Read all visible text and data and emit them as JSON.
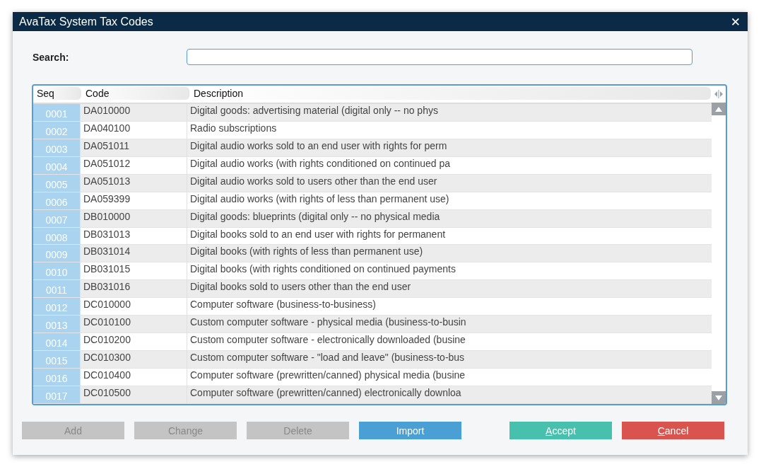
{
  "window": {
    "title": "AvaTax System Tax Codes",
    "close": "✕"
  },
  "search": {
    "label": "Search:"
  },
  "table": {
    "columns": [
      "Seq",
      "Code",
      "Description"
    ],
    "rows": [
      {
        "seq": "0001",
        "code": "DA010000",
        "description": "Digital goods: advertising material (digital only -- no phys"
      },
      {
        "seq": "0002",
        "code": "DA040100",
        "description": "Radio subscriptions"
      },
      {
        "seq": "0003",
        "code": "DA051011",
        "description": "Digital audio works sold to an end user with rights for perm"
      },
      {
        "seq": "0004",
        "code": "DA051012",
        "description": "Digital audio works (with rights conditioned on continued pa"
      },
      {
        "seq": "0005",
        "code": "DA051013",
        "description": "Digital audio works sold to users other than the end user"
      },
      {
        "seq": "0006",
        "code": "DA059399",
        "description": "Digital audio works (with rights of less than permanent use)"
      },
      {
        "seq": "0007",
        "code": "DB010000",
        "description": "Digital goods: blueprints (digital only -- no physical media"
      },
      {
        "seq": "0008",
        "code": "DB031013",
        "description": "Digital books sold to an end user with rights for permanent"
      },
      {
        "seq": "0009",
        "code": "DB031014",
        "description": "Digital books (with rights of less than permanent use)"
      },
      {
        "seq": "0010",
        "code": "DB031015",
        "description": "Digital books (with rights conditioned on continued payments"
      },
      {
        "seq": "0011",
        "code": "DB031016",
        "description": "Digital books sold to users other than the end user"
      },
      {
        "seq": "0012",
        "code": "DC010000",
        "description": "Computer software (business-to-business)"
      },
      {
        "seq": "0013",
        "code": "DC010100",
        "description": "Custom computer software - physical media (business-to-busin"
      },
      {
        "seq": "0014",
        "code": "DC010200",
        "description": "Custom computer software - electronically downloaded (busine"
      },
      {
        "seq": "0015",
        "code": "DC010300",
        "description": "Custom computer software - \"load and leave\" (business-to-bus"
      },
      {
        "seq": "0016",
        "code": "DC010400",
        "description": "Computer software (prewritten/canned) physical media (busine"
      },
      {
        "seq": "0017",
        "code": "DC010500",
        "description": "Computer software (prewritten/canned) electronically downloa"
      }
    ]
  },
  "buttons": [
    {
      "label": "Add",
      "kind": "neutral",
      "disabled": true,
      "underline_first": false
    },
    {
      "label": "Change",
      "kind": "neutral",
      "disabled": true,
      "underline_first": false
    },
    {
      "label": "Delete",
      "kind": "neutral",
      "disabled": true,
      "underline_first": false
    },
    {
      "label": "Import",
      "kind": "primary",
      "disabled": false,
      "underline_first": false
    },
    {
      "label": "Accept",
      "kind": "accept",
      "disabled": false,
      "underline_first": true
    },
    {
      "label": "Cancel",
      "kind": "cancel",
      "disabled": false,
      "underline_first": true
    }
  ]
}
